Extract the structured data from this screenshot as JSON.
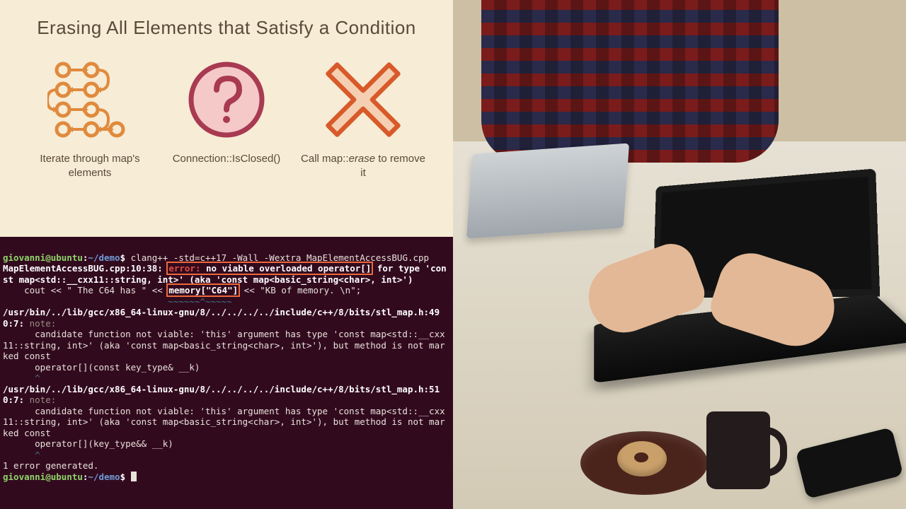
{
  "slide": {
    "title": "Erasing All Elements that Satisfy a Condition",
    "step1": "Iterate through map's elements",
    "step2": "Connection::IsClosed()",
    "step3_a": "Call map::",
    "step3_b": "erase",
    "step3_c": " to remove it"
  },
  "term": {
    "user": "giovanni@ubuntu",
    "path": "~/demo",
    "cmd1": "clang++ -std=c++17 -Wall -Wextra MapElementAccessBUG.cpp",
    "err_loc": "MapElementAccessBUG.cpp:10:38:",
    "err_label": "error:",
    "err_msg1": "no viable overloaded operator[]",
    "err_msg2_a": " for type 'const map<std::__cxx11::string, int>' (aka 'const map<basic_string<char>, int>')",
    "code_a": "    cout << \" The C64 has \" << ",
    "code_hl": "memory[\"C64\"]",
    "code_b": " << \"KB of memory. \\n\";",
    "caret1": "                               ~~~~~~^~~~~~",
    "note_loc1": "/usr/bin/../lib/gcc/x86_64-linux-gnu/8/../../../../include/c++/8/bits/stl_map.h:490:7:",
    "note_label": "note:",
    "note_body1": "      candidate function not viable: 'this' argument has type 'const map<std::__cxx11::string, int>' (aka 'const map<basic_string<char>, int>'), but method is not marked const",
    "note_sig1": "      operator[](const key_type& __k)",
    "caret2": "      ^",
    "note_loc2": "/usr/bin/../lib/gcc/x86_64-linux-gnu/8/../../../../include/c++/8/bits/stl_map.h:510:7:",
    "note_body2": "      candidate function not viable: 'this' argument has type 'const map<std::__cxx11::string, int>' (aka 'const map<basic_string<char>, int>'), but method is not marked const",
    "note_sig2": "      operator[](key_type&& __k)",
    "summary": "1 error generated."
  }
}
